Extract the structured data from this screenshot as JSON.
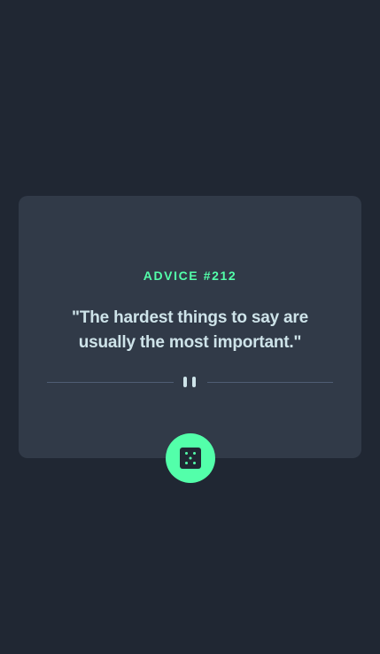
{
  "advice": {
    "id_label": "ADVICE #212",
    "text": "\"The hardest things to say are usually the most important.\""
  },
  "icons": {
    "divider": "pause-icon",
    "button": "dice-icon"
  },
  "colors": {
    "background": "#202733",
    "card": "#313a48",
    "accent": "#53ffaa",
    "text": "#cee3e9",
    "divider": "#4f5d74"
  }
}
